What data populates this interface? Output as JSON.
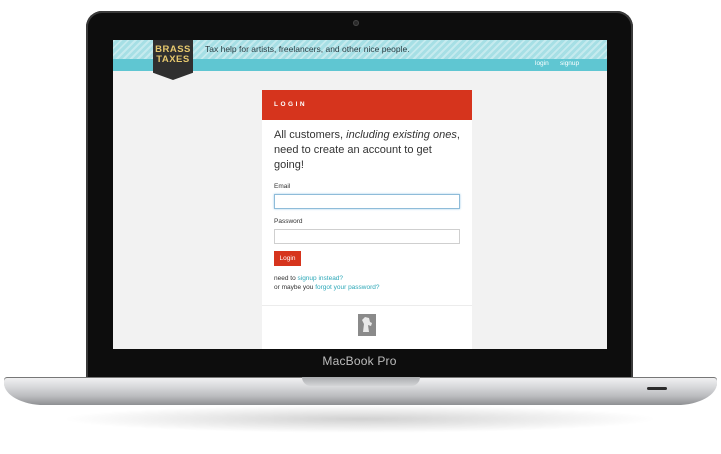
{
  "device": {
    "model_label": "MacBook Pro"
  },
  "site": {
    "logo": {
      "line1": "BRASS",
      "line2": "TAXES"
    },
    "tagline": "Tax help for artists, freelancers, and other nice people.",
    "nav": {
      "login": "login",
      "signup": "signup"
    }
  },
  "login_card": {
    "header": "LOGIN",
    "intro_prefix": "All customers, ",
    "intro_emphasis": "including existing ones",
    "intro_suffix": ", need to create an account to get going!",
    "email_label": "Email",
    "email_value": "",
    "password_label": "Password",
    "password_value": "",
    "login_button": "Login",
    "help_line1_prefix": "need to ",
    "help_line1_link": "signup instead?",
    "help_line2_prefix": "or maybe you ",
    "help_line2_link": "forgot your password?"
  },
  "colors": {
    "accent_red": "#d6341d",
    "header_teal": "#5fc6d2",
    "link_teal": "#2ea8b8"
  }
}
